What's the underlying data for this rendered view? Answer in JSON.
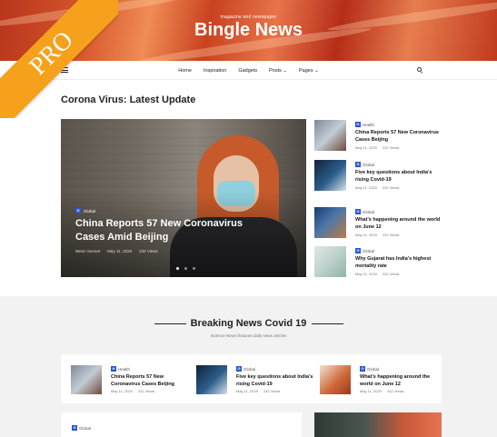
{
  "header": {
    "tagline": "magazine and newspaper",
    "logo": "Bingle News",
    "ribbon": "PRO"
  },
  "nav": {
    "items": [
      "Home",
      "Inspiration",
      "Gadgets",
      "Posts ⌄",
      "Pages ⌄"
    ],
    "menu_icon": "hamburger-icon",
    "search_icon": "search-icon"
  },
  "section": {
    "title": "Corona Virus: Latest Update"
  },
  "hero": {
    "category": "Global",
    "title": "China Reports 57 New Coronavirus Cases Amid Beijing",
    "author": "Wenn Sonnet",
    "date": "May 11, 2020",
    "views": "232 Views"
  },
  "side_list": [
    {
      "category": "Health",
      "title": "China Reports 57 New Coronavirus Cases Beijing",
      "date": "May 11, 2020",
      "views": "232 Views"
    },
    {
      "category": "Global",
      "title": "Five key questions about India's rising Covid-19",
      "date": "May 11, 2020",
      "views": "232 Views"
    },
    {
      "category": "Global",
      "title": "What's happening around the world on June 12",
      "date": "May 11, 2020",
      "views": "232 Views"
    },
    {
      "category": "Global",
      "title": "Why Gujarat has India's highest mortality rate",
      "date": "May 11, 2020",
      "views": "232 Views"
    }
  ],
  "breaking": {
    "title": "Breaking News Covid 19",
    "subtitle": "Science News features daily news articles",
    "cards": [
      {
        "category": "Health",
        "title": "China Reports 57 New Coronavirus Cases Beijing",
        "date": "May 11, 2020",
        "views": "232 Views"
      },
      {
        "category": "Global",
        "title": "Five key questions about India's rising Covid-19",
        "date": "May 11, 2020",
        "views": "232 Views"
      },
      {
        "category": "Global",
        "title": "What's happening around the world on June 12",
        "date": "May 11, 2020",
        "views": "232 Views"
      }
    ],
    "bottom_category": "Global"
  },
  "colors": {
    "accent": "#2b55d6",
    "ribbon": "#f5a11c",
    "banner": "#c9421f"
  }
}
